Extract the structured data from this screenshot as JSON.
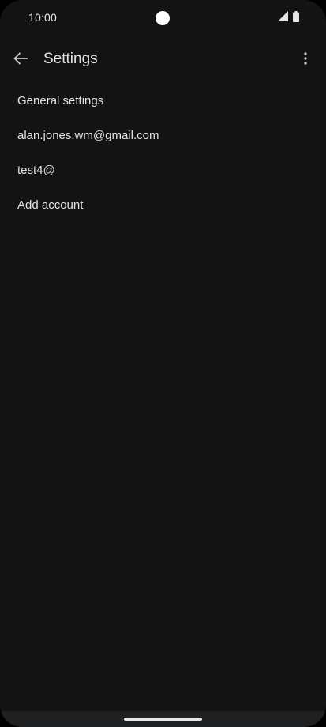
{
  "status_bar": {
    "time": "10:00",
    "icons": [
      "signal-icon",
      "battery-icon"
    ]
  },
  "app_bar": {
    "title": "Settings",
    "back_icon": "arrow-back-icon",
    "overflow_icon": "more-vertical-icon"
  },
  "settings": {
    "items": [
      {
        "label": "General settings"
      },
      {
        "label": "alan.jones.wm@gmail.com"
      },
      {
        "label": "test4@"
      },
      {
        "label": "Add account"
      }
    ]
  },
  "colors": {
    "background": "#131314",
    "text": "#e3e3e3",
    "nav_bar": "#1f2022"
  }
}
